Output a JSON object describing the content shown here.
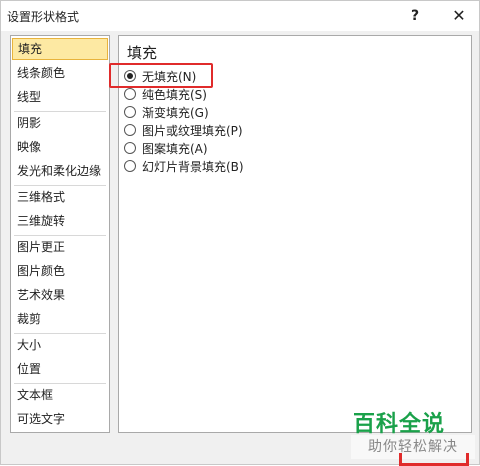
{
  "window": {
    "title": "设置形状格式",
    "help_symbol": "?",
    "close_symbol": "✕"
  },
  "nav": {
    "items": [
      {
        "label": "填充"
      },
      {
        "label": "线条颜色"
      },
      {
        "label": "线型"
      },
      {
        "label": "阴影"
      },
      {
        "label": "映像"
      },
      {
        "label": "发光和柔化边缘"
      },
      {
        "label": "三维格式"
      },
      {
        "label": "三维旋转"
      },
      {
        "label": "图片更正"
      },
      {
        "label": "图片颜色"
      },
      {
        "label": "艺术效果"
      },
      {
        "label": "裁剪"
      },
      {
        "label": "大小"
      },
      {
        "label": "位置"
      },
      {
        "label": "文本框"
      },
      {
        "label": "可选文字"
      }
    ],
    "selected": "填充"
  },
  "panel": {
    "title": "填充",
    "options": [
      {
        "label": "无填充(N)",
        "checked": true
      },
      {
        "label": "纯色填充(S)",
        "checked": false
      },
      {
        "label": "渐变填充(G)",
        "checked": false
      },
      {
        "label": "图片或纹理填充(P)",
        "checked": false
      },
      {
        "label": "图案填充(A)",
        "checked": false
      },
      {
        "label": "幻灯片背景填充(B)",
        "checked": false
      }
    ]
  },
  "watermark": {
    "title": "百科全说",
    "subtitle": "助你轻松解决"
  },
  "colors": {
    "selected_bg": "#fde9a3",
    "selected_border": "#e8b33c",
    "highlight": "#e02b2b",
    "watermark_green": "#1aa14a"
  }
}
